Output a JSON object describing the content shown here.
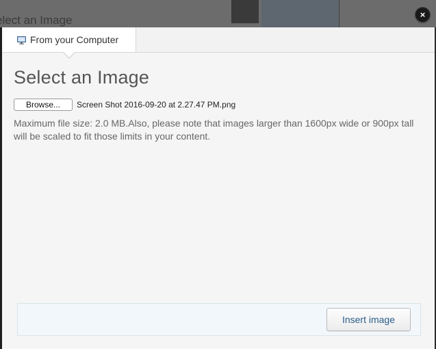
{
  "background": {
    "title_fragment": "elect an Image"
  },
  "dialog": {
    "close_label": "×",
    "tabs": [
      {
        "label": "From your Computer",
        "icon": "computer-icon",
        "active": true
      }
    ],
    "heading": "Select an Image",
    "file_input": {
      "button_label": "Browse...",
      "selected_file": "Screen Shot 2016-09-20 at 2.27.47 PM.png"
    },
    "note": "Maximum file size: 2.0 MB.Also, please note that images larger than 1600px wide or 900px tall will be scaled to fit those limits in your content.",
    "footer": {
      "insert_label": "Insert image"
    }
  },
  "colors": {
    "dialog_bg": "#f5f5f5",
    "footer_bg": "#f1f7fa",
    "link_blue": "#2a5d8a",
    "overlay": "#2b2b2b"
  }
}
